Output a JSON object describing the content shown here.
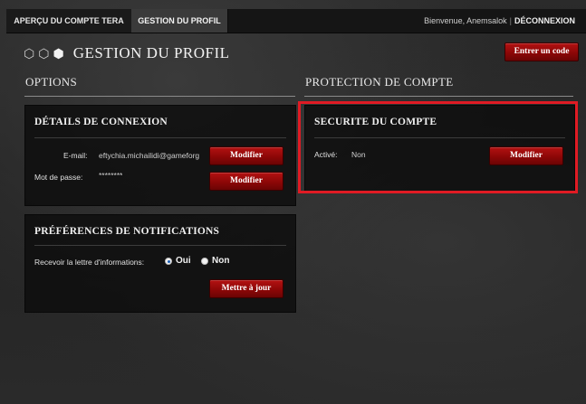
{
  "tabs": [
    {
      "label": "APERÇU DU COMPTE TERA"
    },
    {
      "label": "GESTION DU PROFIL"
    }
  ],
  "header": {
    "welcome": "Bienvenue, Anemsalok",
    "separator": "|",
    "logout": "DÉCONNEXION"
  },
  "page": {
    "title": "GESTION DU PROFIL",
    "code_button": "Entrer un code"
  },
  "sections": {
    "options": "OPTIONS",
    "protection": "PROTECTION DE COMPTE"
  },
  "connexion": {
    "title": "DÉTAILS DE CONNEXION",
    "email_label": "E-mail:",
    "email_value": "eftychia.michailidi@gameforg",
    "email_button": "Modifier",
    "password_label": "Mot de passe:",
    "password_value": "********",
    "password_button": "Modifier"
  },
  "notifications": {
    "title": "PRÉFÉRENCES DE NOTIFICATIONS",
    "newsletter_label": "Recevoir la lettre d'informations:",
    "option_yes": "Oui",
    "option_no": "Non",
    "selected": "Oui",
    "update_button": "Mettre à jour"
  },
  "security": {
    "title": "SECURITE DU COMPTE",
    "active_label": "Activé:",
    "active_value": "Non",
    "button": "Modifier"
  },
  "colors": {
    "accent": "#8d0707",
    "highlight": "#e01b24"
  }
}
